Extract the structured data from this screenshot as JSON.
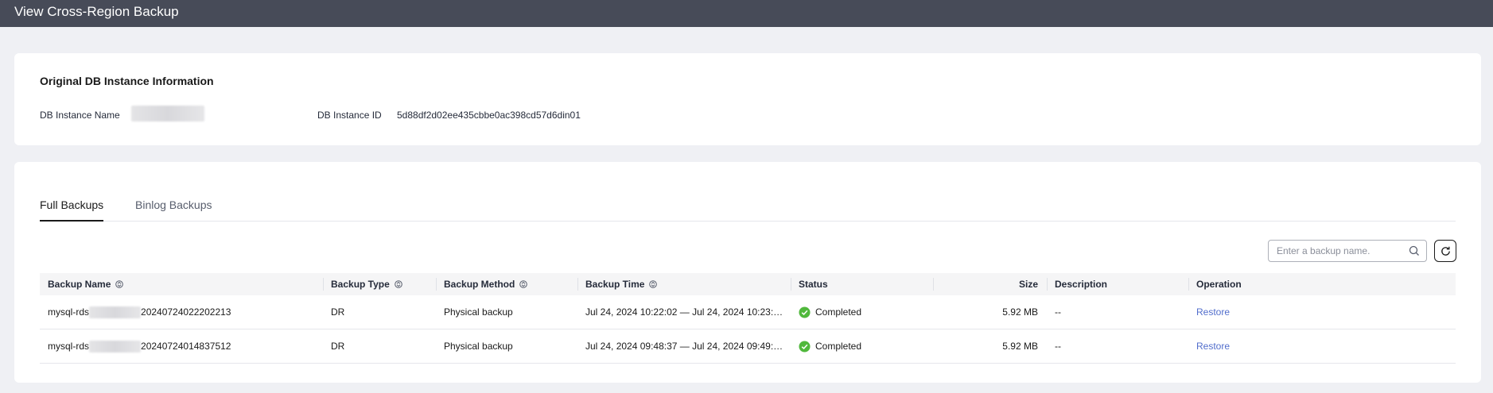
{
  "header": {
    "title": "View Cross-Region Backup"
  },
  "instance_info": {
    "title": "Original DB Instance Information",
    "name_label": "DB Instance Name",
    "id_label": "DB Instance ID",
    "id_value": "5d88df2d02ee435cbbe0ac398cd57d6din01"
  },
  "tabs": [
    {
      "label": "Full Backups",
      "active": true
    },
    {
      "label": "Binlog Backups",
      "active": false
    }
  ],
  "search": {
    "placeholder": "Enter a backup name."
  },
  "table": {
    "columns": [
      "Backup Name",
      "Backup Type",
      "Backup Method",
      "Backup Time",
      "Status",
      "Size",
      "Description",
      "Operation"
    ],
    "rows": [
      {
        "name_prefix": "mysql-rds",
        "name_suffix": "20240724022202213",
        "type": "DR",
        "method": "Physical backup",
        "time": "Jul 24, 2024 10:22:02 — Jul 24, 2024 10:23:…",
        "status": "Completed",
        "size": "5.92 MB",
        "description": "--",
        "operation": "Restore"
      },
      {
        "name_prefix": "mysql-rds",
        "name_suffix": "20240724014837512",
        "type": "DR",
        "method": "Physical backup",
        "time": "Jul 24, 2024 09:48:37 — Jul 24, 2024 09:49:…",
        "status": "Completed",
        "size": "5.92 MB",
        "description": "--",
        "operation": "Restore"
      }
    ]
  },
  "colors": {
    "topbar": "#474b58",
    "accent": "#526ecc",
    "success": "#50b83c"
  }
}
